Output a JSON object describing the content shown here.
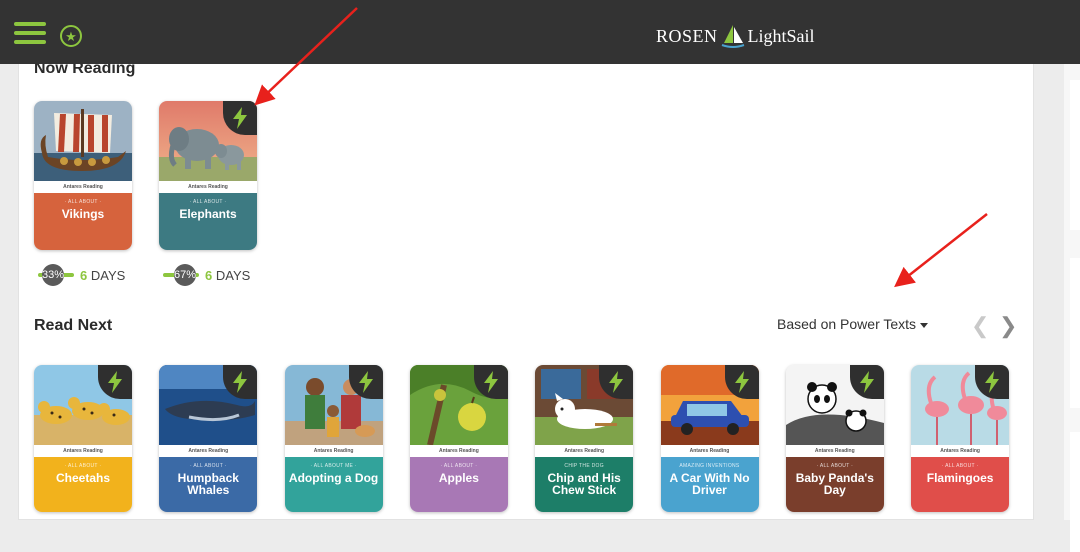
{
  "header": {
    "logo_left": "ROSEN",
    "logo_right": "LightSail"
  },
  "colors": {
    "accent_green": "#8dc63f",
    "topbar": "#333333",
    "annotation_arrow": "#e8211c"
  },
  "now_reading": {
    "title": "Now Reading",
    "books": [
      {
        "series": "· ALL ABOUT ·",
        "title": "Vikings",
        "color": "#d6633d",
        "has_power": false,
        "progress_label": "33%",
        "progress": 0.33,
        "days_num": "6",
        "days_label": "DAYS"
      },
      {
        "series": "· ALL ABOUT ·",
        "title": "Elephants",
        "color": "#3d7a82",
        "has_power": true,
        "progress_label": "67%",
        "progress": 0.67,
        "days_num": "6",
        "days_label": "DAYS"
      }
    ]
  },
  "read_next": {
    "title": "Read Next",
    "sort_label": "Based on Power Texts",
    "brand_text": "Antares Reading",
    "books": [
      {
        "series": "· ALL ABOUT ·",
        "title": "Cheetahs",
        "color": "#f2b21c",
        "art": "cheetahs"
      },
      {
        "series": "· ALL ABOUT ·",
        "title": "Humpback Whales",
        "color": "#3b6aa6",
        "art": "whales"
      },
      {
        "series": "· ALL ABOUT ME ·",
        "title": "Adopting a Dog",
        "color": "#32a39b",
        "art": "family"
      },
      {
        "series": "· ALL ABOUT ·",
        "title": "Apples",
        "color": "#a878b5",
        "art": "apples"
      },
      {
        "series": "CHIP THE DOG",
        "title": "Chip and His Chew Stick",
        "color": "#1d7e68",
        "art": "dog"
      },
      {
        "series": "AMAZING INVENTIONS",
        "title": "A Car With No Driver",
        "color": "#4aa3cf",
        "art": "car"
      },
      {
        "series": "· ALL ABOUT ·",
        "title": "Baby Panda's Day",
        "color": "#7a3e2c",
        "art": "panda"
      },
      {
        "series": "· ALL ABOUT ·",
        "title": "Flamingoes",
        "color": "#e04e4a",
        "art": "flamingo"
      }
    ]
  },
  "icons": {
    "menu": "hamburger-icon",
    "favorites": "star-circle-icon",
    "power": "lightning-bolt-icon",
    "prev": "chevron-left-icon",
    "next": "chevron-right-icon"
  }
}
